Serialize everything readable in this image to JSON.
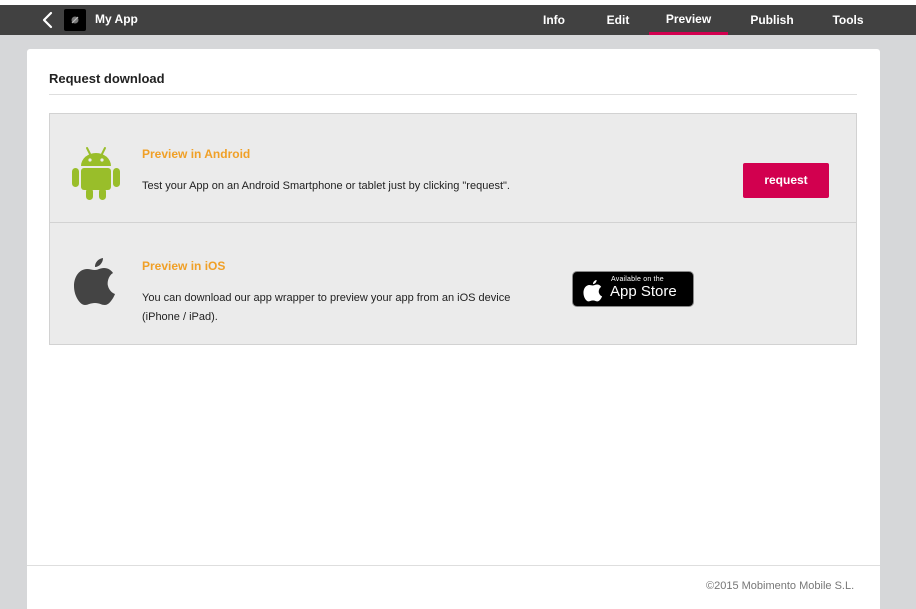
{
  "header": {
    "app_name": "My App",
    "tabs": [
      {
        "label": "Info"
      },
      {
        "label": "Edit"
      },
      {
        "label": "Preview"
      },
      {
        "label": "Publish"
      },
      {
        "label": "Tools"
      }
    ],
    "active_tab": "Preview",
    "accent_color": "#d2004f"
  },
  "page": {
    "title": "Request download"
  },
  "android": {
    "icon": "android-icon",
    "title": "Preview in Android",
    "description": "Test your App on an Android Smartphone or tablet just by clicking \"request\".",
    "button_label": "request"
  },
  "ios": {
    "icon": "apple-icon",
    "title": "Preview in iOS",
    "description": "You can download our app wrapper to preview your app from an iOS device (iPhone / iPad).",
    "badge_small": "Available on the",
    "badge_big": "App Store"
  },
  "footer": {
    "copyright": "©2015 Mobimento Mobile S.L."
  }
}
